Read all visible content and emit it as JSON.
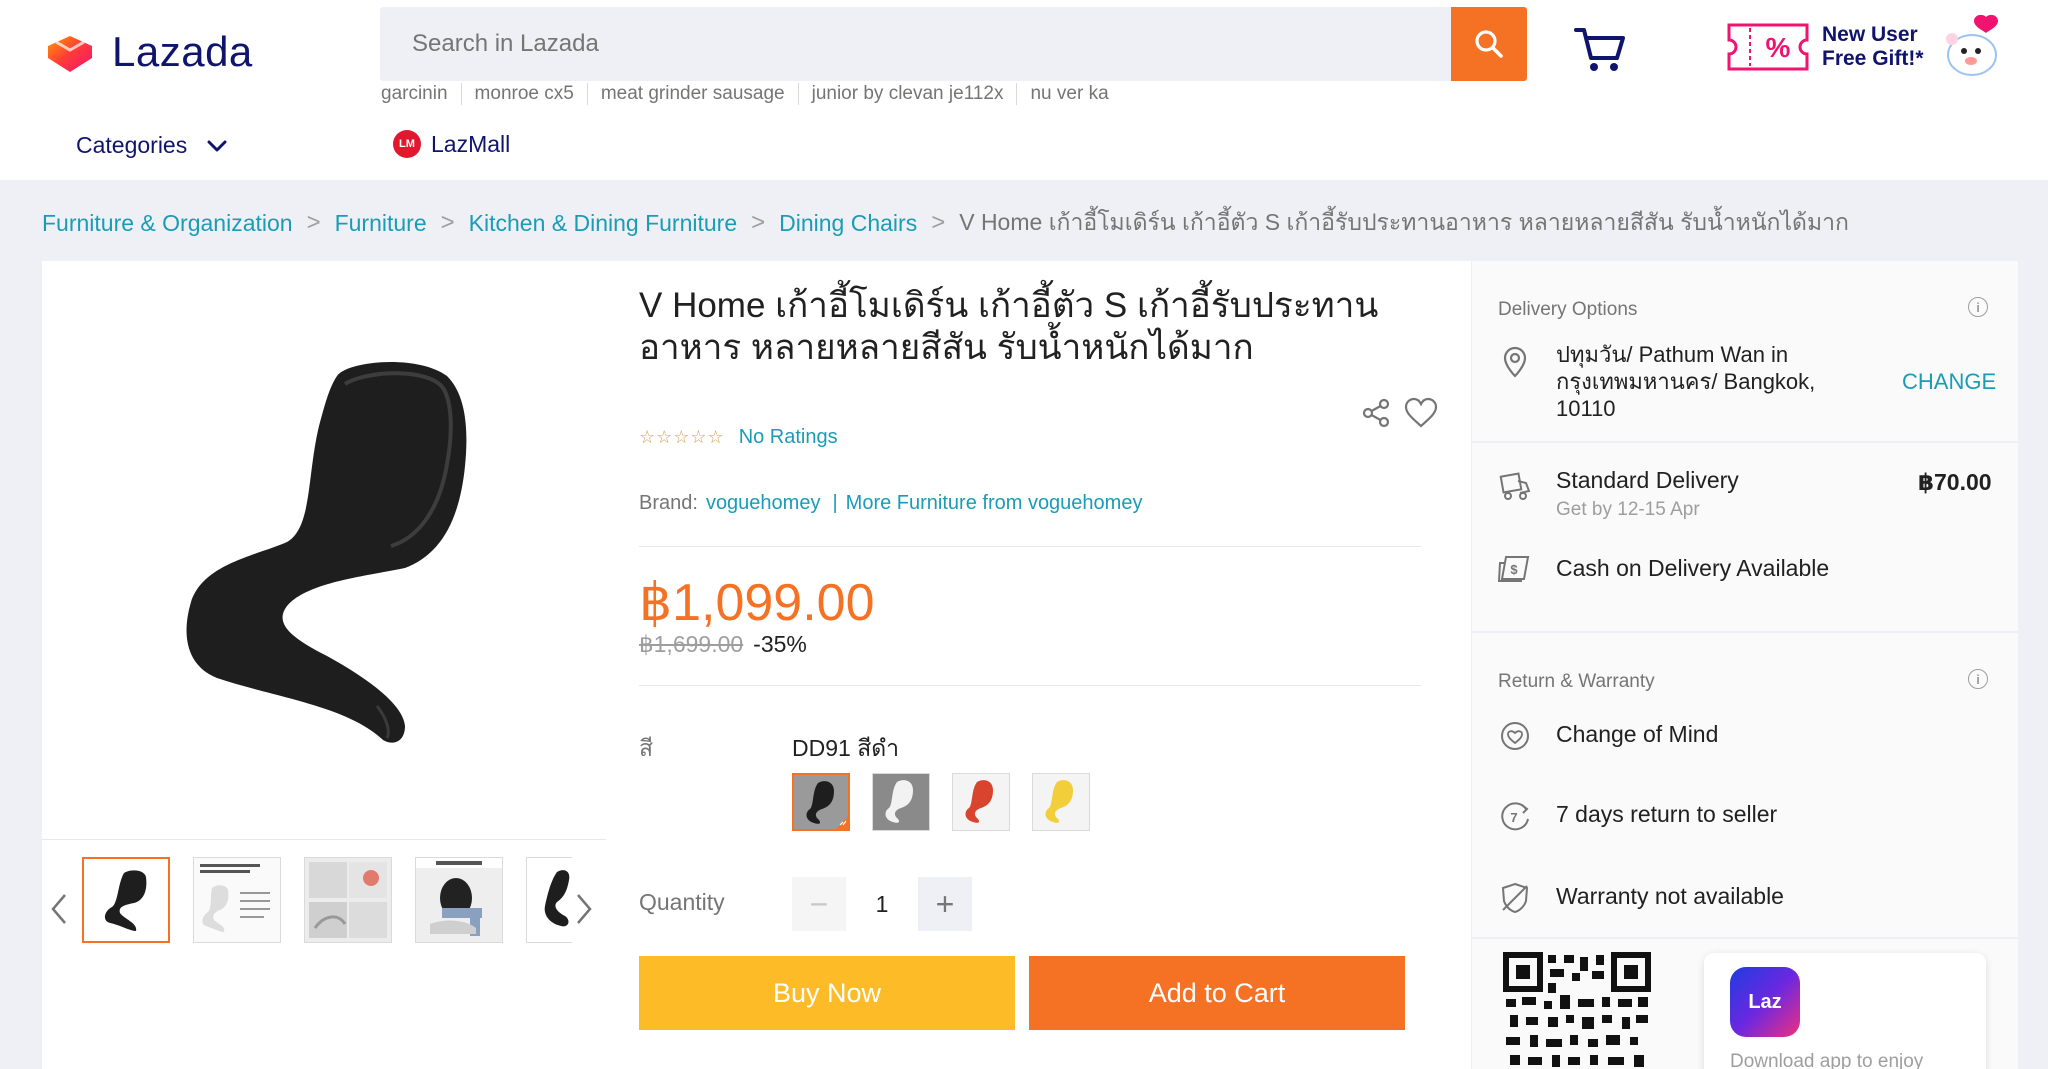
{
  "header": {
    "logo_text": "Lazada",
    "search_placeholder": "Search in Lazada",
    "suggestions": [
      "garcinin",
      "monroe cx5",
      "meat grinder sausage",
      "junior by clevan je112x",
      "nu ver ka"
    ],
    "categories_label": "Categories",
    "lazmall_label": "LazMall",
    "promo_text_line1": "New User",
    "promo_text_line2": "Free Gift!*",
    "promo_coupon_text": "%"
  },
  "breadcrumb": {
    "items": [
      "Furniture & Organization",
      "Furniture",
      "Kitchen & Dining Furniture",
      "Dining Chairs"
    ],
    "current": "V Home เก้าอี้โมเดิร์น เก้าอี้ตัว S เก้าอี้รับประทานอาหาร หลายหลายสีสัน รับน้ำหนักได้มาก",
    "separator": ">"
  },
  "product": {
    "title": "V Home เก้าอี้โมเดิร์น เก้าอี้ตัว S เก้าอี้รับประทานอาหาร หลายหลายสีสัน รับน้ำหนักได้มาก",
    "rating_stars": "☆☆☆☆☆",
    "rating_text": "No Ratings",
    "brand_label": "Brand:",
    "brand_name": "voguehomey",
    "brand_sep": "|",
    "more_from": "More Furniture from voguehomey",
    "price": "฿1,099.00",
    "original_price": "฿1,699.00",
    "discount": "-35%",
    "color_label": "สี",
    "color_selected": "DD91 สีดำ",
    "swatch_colors": [
      "#2b2b2b",
      "#e6e6e6",
      "#d9442f",
      "#f2cf3a"
    ],
    "quantity_label": "Quantity",
    "quantity_value": "1",
    "quantity_minus": "−",
    "quantity_plus": "+",
    "buy_now": "Buy Now",
    "add_to_cart": "Add to Cart"
  },
  "thumbnails": {
    "captions": [
      "",
      "",
      "",
      "",
      ""
    ],
    "thumb2_text": "\"Skypanne\nผลิตของเก้าอี้สำหรับผู้ขายราย\"",
    "thumb4_text": "รับน้ำหนักได้ถึง 100 กก."
  },
  "side": {
    "delivery_title": "Delivery Options",
    "location": "ปทุมวัน/ Pathum Wan in กรุงเทพมหานคร/ Bangkok, 10110",
    "change": "CHANGE",
    "standard_delivery": "Standard Delivery",
    "standard_eta": "Get by 12-15 Apr",
    "standard_price": "฿70.00",
    "cod": "Cash on Delivery Available",
    "return_title": "Return & Warranty",
    "change_of_mind": "Change of Mind",
    "return_days": "7 days return to seller",
    "warranty": "Warranty not available",
    "info_symbol": "i",
    "app_logo_text": "Laz",
    "app_text": "Download app to enjoy"
  },
  "colors": {
    "brand_orange": "#f57224",
    "buy_yellow": "#fdbb28",
    "link_teal": "#1a9cb7",
    "navy": "#0f146d"
  }
}
